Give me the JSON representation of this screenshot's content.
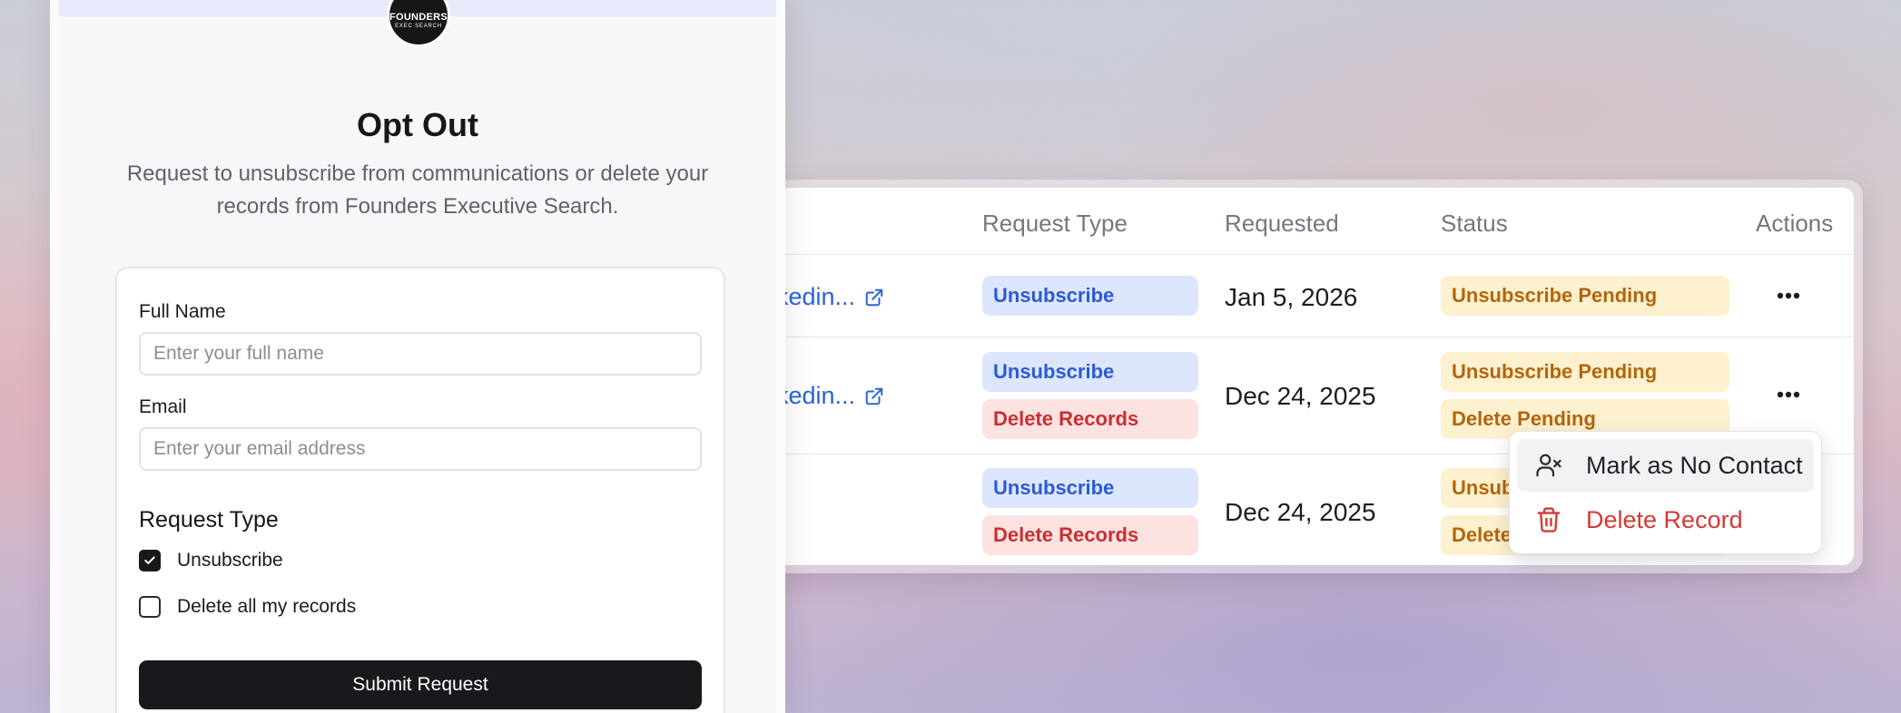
{
  "table": {
    "headers": {
      "request_type": "Request Type",
      "requested": "Requested",
      "status": "Status",
      "actions": "Actions"
    },
    "rows": [
      {
        "link": "kedin...",
        "request_types": [
          "Unsubscribe"
        ],
        "requested": "Jan 5, 2026",
        "statuses": [
          "Unsubscribe Pending"
        ]
      },
      {
        "link": "kedin...",
        "request_types": [
          "Unsubscribe",
          "Delete Records"
        ],
        "requested": "Dec 24, 2025",
        "statuses": [
          "Unsubscribe Pending",
          "Delete Pending"
        ]
      },
      {
        "link": "",
        "request_types": [
          "Unsubscribe",
          "Delete Records"
        ],
        "requested": "Dec 24, 2025",
        "statuses": [
          "Unsub",
          "Delete"
        ]
      }
    ]
  },
  "menu": {
    "mark_no_contact": "Mark as No Contact",
    "delete_record": "Delete Record"
  },
  "form": {
    "logo_line1": "FOUNDERS",
    "logo_line2": "EXEC SEARCH",
    "title": "Opt Out",
    "subtitle": "Request to unsubscribe from communications or delete your records from Founders Executive Search.",
    "full_name_label": "Full Name",
    "full_name_placeholder": "Enter your full name",
    "email_label": "Email",
    "email_placeholder": "Enter your email address",
    "request_type_title": "Request Type",
    "option_unsubscribe": "Unsubscribe",
    "option_unsubscribe_checked": true,
    "option_delete": "Delete all my records",
    "option_delete_checked": false,
    "submit_label": "Submit Request"
  },
  "colors": {
    "link": "#2b63d9",
    "badge_blue": "#dde6fc",
    "badge_red": "#fde2e2",
    "badge_amber": "#fdf1cf",
    "danger": "#d23a36",
    "primary_button": "#18191c"
  },
  "icons": {
    "external_link": "external-link-icon",
    "more": "more-horizontal-icon",
    "user_x": "user-x-icon",
    "trash": "trash-icon",
    "check": "check-icon"
  }
}
